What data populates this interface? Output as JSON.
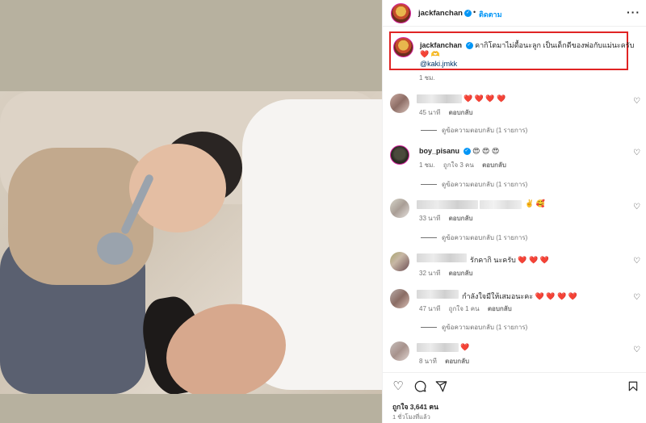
{
  "post": {
    "username": "jackfanchan",
    "follow_label": "ติดตาม",
    "caption_text": "คากิโตมาไม่ดื้อนะลูก เป็นเด็กดีของพ่อกับแม่นะครับ",
    "caption_emoji": "❤️ 🫶",
    "mention": "@kaki.jmkk",
    "caption_time": "1 ชม."
  },
  "comments": [
    {
      "text": "❤️ ❤️ ❤️ ❤️",
      "time": "45 นาที",
      "reply_label": "ตอบกลับ",
      "replies": "ดูข้อความตอบกลับ (1 รายการ)"
    },
    {
      "username": "boy_pisanu",
      "text": "😍 😍 😍",
      "time": "1 ชม.",
      "likes": "ถูกใจ 3 คน",
      "reply_label": "ตอบกลับ",
      "replies": "ดูข้อความตอบกลับ (1 รายการ)"
    },
    {
      "text": "✌️ 🥰",
      "time": "33 นาที",
      "reply_label": "ตอบกลับ",
      "replies": "ดูข้อความตอบกลับ (1 รายการ)"
    },
    {
      "text": "รักคากิ นะครับ ❤️ ❤️ ❤️",
      "time": "32 นาที",
      "reply_label": "ตอบกลับ"
    },
    {
      "text": "กำลังใจมีให้เสมอนะคะ ❤️ ❤️ ❤️ ❤️",
      "time": "47 นาที",
      "likes": "ถูกใจ 1 คน",
      "reply_label": "ตอบกลับ",
      "replies": "ดูข้อความตอบกลับ (1 รายการ)"
    },
    {
      "text": "❤️",
      "time": "8 นาที",
      "reply_label": "ตอบกลับ"
    }
  ],
  "footer": {
    "likes": "ถูกใจ 3,641 คน",
    "posted": "1 ชั่วโมงที่แล้ว"
  },
  "icons": {
    "like": "heart-icon",
    "comment": "comment-icon",
    "share": "share-icon",
    "save": "bookmark-icon",
    "more": "more-icon"
  },
  "colors": {
    "accent": "#0095f6",
    "highlight_box": "#e02424",
    "heart": "#ed4956"
  }
}
